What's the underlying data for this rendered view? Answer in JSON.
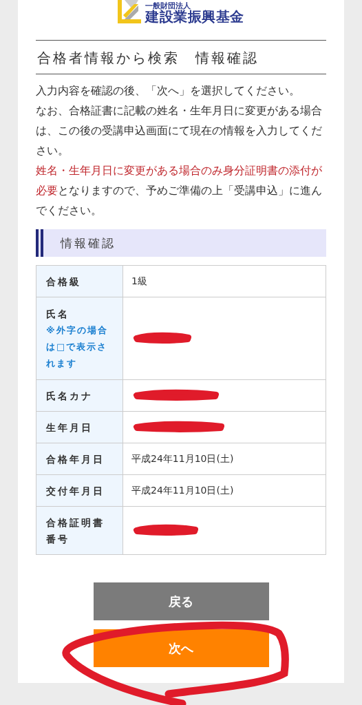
{
  "logo": {
    "subtitle": "一般財団法人",
    "name": "建設業振興基金"
  },
  "title": "合格者情報から検索　情報確認",
  "paragraphs": [
    {
      "text": "入力内容を確認の後、「次へ」を選択してください。"
    },
    {
      "text": "なお、合格証書に記載の姓名・生年月日に変更がある場合は、この後の受講申込画面にて現在の情報を入力してください。"
    },
    {
      "warning": "姓名・生年月日に変更がある場合のみ身分証明書の添付が必要",
      "text": "となりますので、予めご準備の上「受講申込」に進んでください。"
    }
  ],
  "section_heading": "情報確認",
  "table": {
    "rows": [
      {
        "label": "合格級",
        "value": "1級"
      },
      {
        "label": "氏名",
        "note": "※外字の場合は□で表示されます",
        "redacted": true
      },
      {
        "label": "氏名カナ",
        "redacted": true
      },
      {
        "label": "生年月日",
        "redacted": true
      },
      {
        "label": "合格年月日",
        "value": "平成24年11月10日(土)"
      },
      {
        "label": "交付年月日",
        "value": "平成24年11月10日(土)"
      },
      {
        "label": "合格証明書番号",
        "redacted": true
      }
    ]
  },
  "buttons": [
    {
      "kind": "back",
      "label": "戻る"
    },
    {
      "kind": "next",
      "label": "次へ",
      "circled": true
    }
  ]
}
